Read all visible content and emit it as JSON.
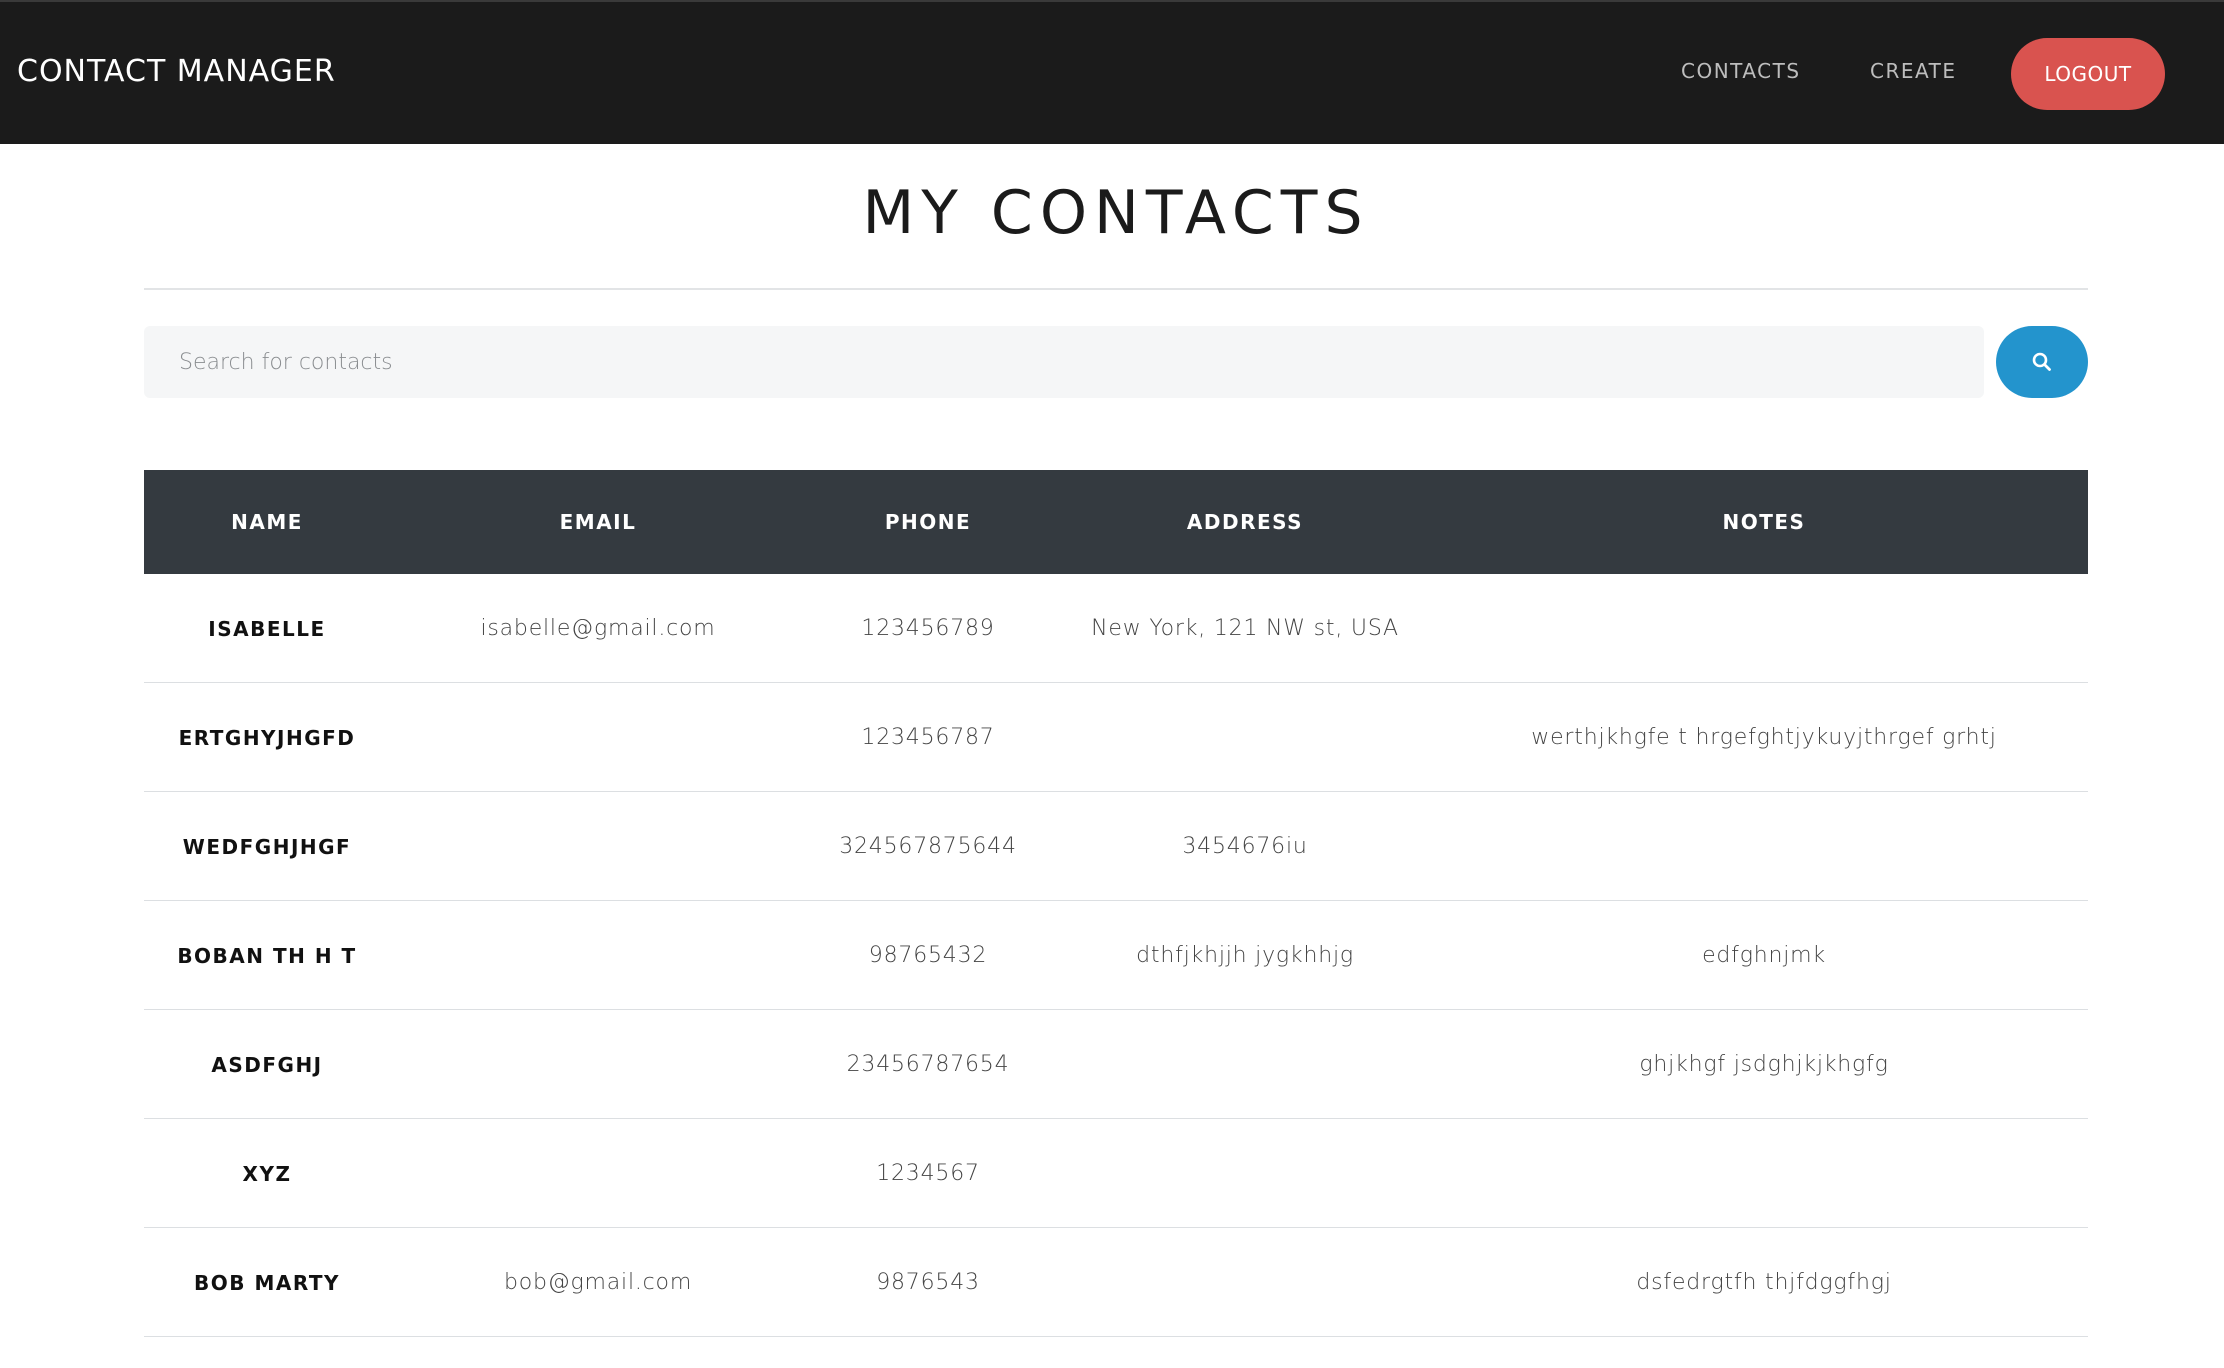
{
  "navbar": {
    "brand": "CONTACT MANAGER",
    "links": [
      "CONTACTS",
      "CREATE"
    ],
    "logout_label": "LOGOUT",
    "logout_color": "#d9534f",
    "background": "#1b1b1b"
  },
  "page": {
    "title": "MY CONTACTS"
  },
  "search": {
    "placeholder": "Search for contacts",
    "value": "",
    "button_icon": "search-icon",
    "button_color": "#2394cd"
  },
  "table": {
    "header_background": "#343a40",
    "columns": [
      "NAME",
      "EMAIL",
      "PHONE",
      "ADDRESS",
      "NOTES"
    ],
    "rows": [
      {
        "name": "ISABELLE",
        "email": "isabelle@gmail.com",
        "phone": "123456789",
        "address": "New York, 121 NW st, USA",
        "notes": ""
      },
      {
        "name": "ERTGHYJHGFD",
        "email": "",
        "phone": "123456787",
        "address": "",
        "notes": "werthjkhgfe t hrgefghtjykuyjthrgef grhtj"
      },
      {
        "name": "WEDFGHJHGF",
        "email": "",
        "phone": "324567875644",
        "address": "3454676iu",
        "notes": ""
      },
      {
        "name": "BOBAN TH H T",
        "email": "",
        "phone": "98765432",
        "address": "dthfjkhjjh jygkhhjg",
        "notes": "edfghnjmk"
      },
      {
        "name": "ASDFGHJ",
        "email": "",
        "phone": "23456787654",
        "address": "",
        "notes": "ghjkhgf jsdghjkjkhgfg"
      },
      {
        "name": "XYZ",
        "email": "",
        "phone": "1234567",
        "address": "",
        "notes": ""
      },
      {
        "name": "BOB MARTY",
        "email": "bob@gmail.com",
        "phone": "9876543",
        "address": "",
        "notes": "dsfedrgtfh thjfdggfhgj"
      }
    ]
  }
}
